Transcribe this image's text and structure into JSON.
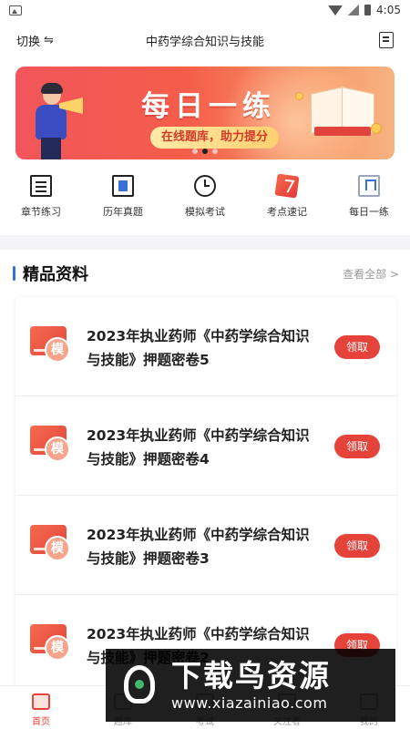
{
  "status_bar": {
    "time": "4:05"
  },
  "header": {
    "switch_label": "切换",
    "switch_icon": "⇋",
    "title": "中药学综合知识与技能"
  },
  "banner": {
    "title": "每日一练",
    "subtitle": "在线题库，助力提分",
    "slide_count": 3,
    "active_slide": 2
  },
  "quick_nav": [
    {
      "label": "章节练习",
      "icon": "chapter-practice-icon"
    },
    {
      "label": "历年真题",
      "icon": "past-exams-icon"
    },
    {
      "label": "模拟考试",
      "icon": "mock-exam-icon"
    },
    {
      "label": "考点速记",
      "icon": "key-points-icon"
    },
    {
      "label": "每日一练",
      "icon": "daily-practice-icon"
    }
  ],
  "section": {
    "title": "精品资料",
    "more": "查看全部 >"
  },
  "materials": [
    {
      "badge": "模",
      "title": "2023年执业药师《中药学综合知识与技能》押题密卷5",
      "action": "领取"
    },
    {
      "badge": "模",
      "title": "2023年执业药师《中药学综合知识与技能》押题密卷4",
      "action": "领取"
    },
    {
      "badge": "模",
      "title": "2023年执业药师《中药学综合知识与技能》押题密卷3",
      "action": "领取"
    },
    {
      "badge": "模",
      "title": "2023年执业药师《中药学综合知识与技能》押题密卷2",
      "action": "领取"
    }
  ],
  "tab_bar": [
    {
      "label": "首页",
      "active": true
    },
    {
      "label": "题库",
      "active": false
    },
    {
      "label": "考试",
      "active": false
    },
    {
      "label": "关注者",
      "active": false
    },
    {
      "label": "我的",
      "active": false
    }
  ],
  "watermark": {
    "text": "下载鸟资源",
    "url": "www.xiazainiao.com"
  },
  "colors": {
    "accent": "#e5423a",
    "section_bar": "#3a6fd8",
    "banner_start": "#f2565a",
    "banner_end": "#f7b282"
  }
}
